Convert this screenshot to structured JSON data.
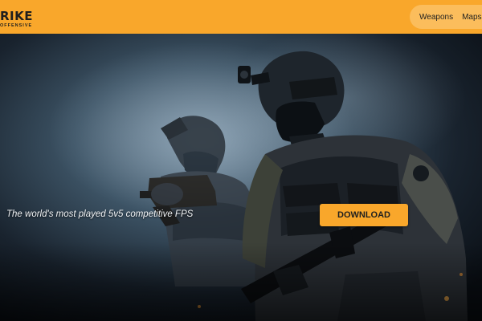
{
  "header": {
    "logo_main": "RIKE",
    "logo_sub": "OFFENSIVE",
    "nav": [
      {
        "label": "Weapons"
      },
      {
        "label": "Maps"
      }
    ]
  },
  "hero": {
    "tagline": "The world's most played 5v5 competitive FPS",
    "download_label": "DOWNLOAD",
    "image_subject": "two tactical soldiers with rifles"
  },
  "colors": {
    "accent": "#f9a72b",
    "nav_pill": "#fbbd5c",
    "hero_bg_dark": "#0d141c",
    "hero_bg_light": "#6e879b"
  }
}
